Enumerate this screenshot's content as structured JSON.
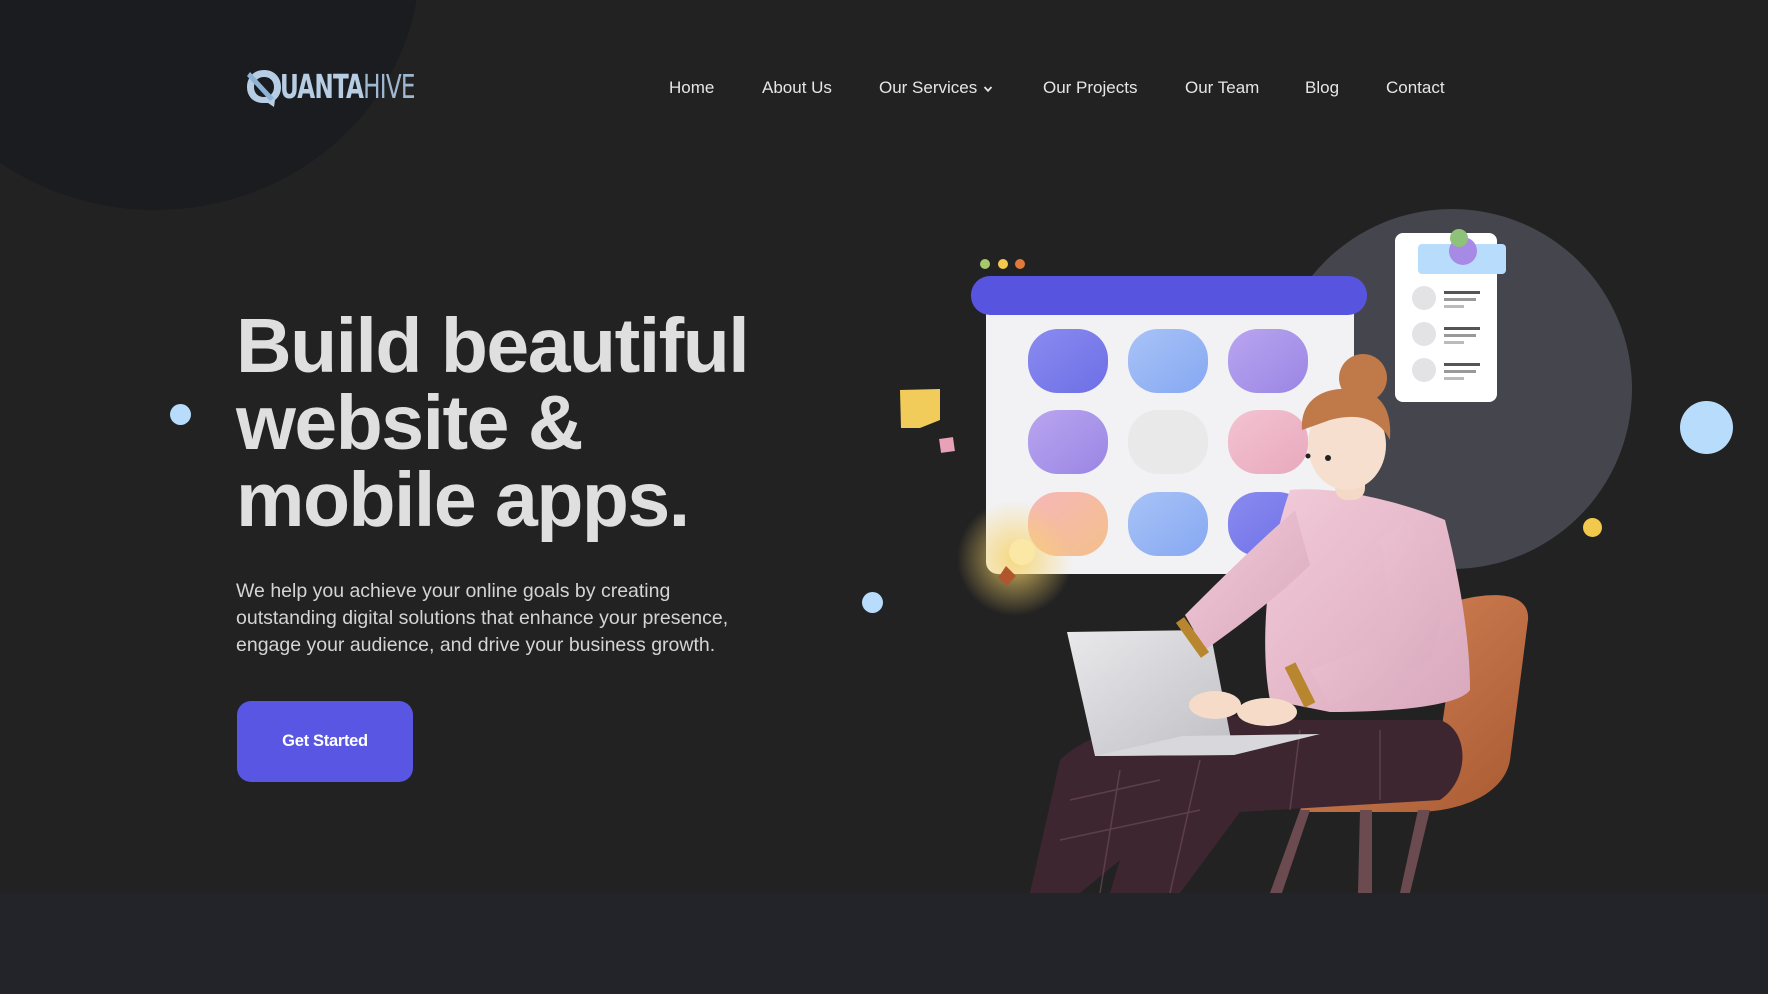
{
  "brand": {
    "logo_bold": "UANTA",
    "logo_light": "HIVE"
  },
  "nav": {
    "items": [
      {
        "label": "Home"
      },
      {
        "label": "About Us"
      },
      {
        "label": "Our Services",
        "has_dropdown": true
      },
      {
        "label": "Our Projects"
      },
      {
        "label": "Our Team"
      },
      {
        "label": "Blog"
      },
      {
        "label": "Contact"
      }
    ]
  },
  "hero": {
    "headline_lines": [
      "Build beautiful",
      "website &",
      "mobile apps."
    ],
    "subtitle_lines": [
      "We help you achieve your online goals by creating",
      "outstanding digital solutions that enhance your presence,",
      "engage your audience, and drive your business growth."
    ],
    "cta_label": "Get Started"
  },
  "icons": {
    "logo": "quantahive-logo-icon",
    "dropdown": "chevron-down-icon",
    "illustration": "woman-with-laptop-illustration"
  },
  "colors": {
    "background": "#222222",
    "lower_band": "#232429",
    "accent": "#5856e2",
    "headline": "#dfdfdf",
    "logo": "#b6cde4",
    "dot_blue": "#b8dcfb",
    "dot_yellow": "#f2c94c"
  }
}
